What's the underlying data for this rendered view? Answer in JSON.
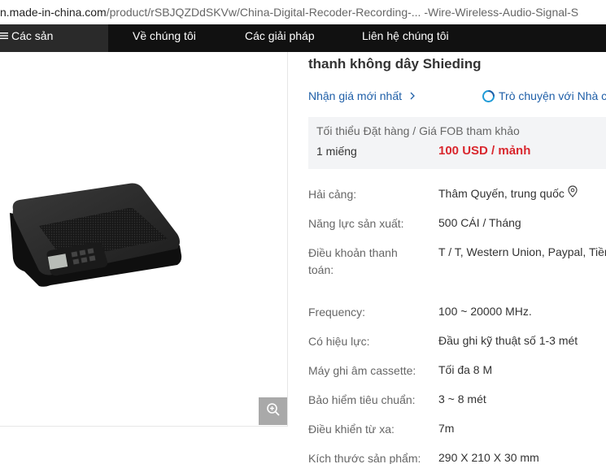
{
  "browser": {
    "url_host": "n.made-in-china.com",
    "url_path": "/product/rSBJQZDdSKVw/China-Digital-Recoder-Recording-... -Wire-Wireless-Audio-Signal-S"
  },
  "nav": {
    "products": "Các sản phẩm",
    "about": "Về chúng tôi",
    "solutions": "Các giải pháp",
    "contact": "Liên hệ chúng tôi"
  },
  "product": {
    "title": "thanh không dây Shieding",
    "latest_price_link": "Nhận giá mới nhất",
    "chat_link": "Trò chuyện với Nhà c",
    "price_box": {
      "header": "Tối thiểu Đặt hàng / Giá FOB tham khảo",
      "quantity": "1 miếng",
      "price": "100 USD / mảnh"
    },
    "specs": [
      {
        "label": "Hải cảng:",
        "value": "Thâm Quyến, trung quốc"
      },
      {
        "label": "Năng lực sản xuất:",
        "value": "500 CÁI / Tháng"
      },
      {
        "label": "Điều khoản thanh toán:",
        "value": "T / T, Western Union, Paypal, Tiền"
      },
      {
        "label": "Frequency:",
        "value": "100 ~ 20000 MHz."
      },
      {
        "label": "Có hiệu lực:",
        "value": "Đầu ghi kỹ thuật số 1-3 mét"
      },
      {
        "label": "Máy ghi âm cassette:",
        "value": "Tối đa 8 M"
      },
      {
        "label": "Bảo hiểm tiêu chuẩn:",
        "value": "3 ~ 8 mét"
      },
      {
        "label": "Điều khiển từ xa:",
        "value": "7m"
      },
      {
        "label": "Kích thước sản phẩm:",
        "value": "290 X 210 X 30 mm"
      }
    ]
  },
  "colors": {
    "nav_bg": "#111111",
    "link": "#1f5fa8",
    "price": "#d9272e",
    "price_box_bg": "#f3f4f6"
  }
}
